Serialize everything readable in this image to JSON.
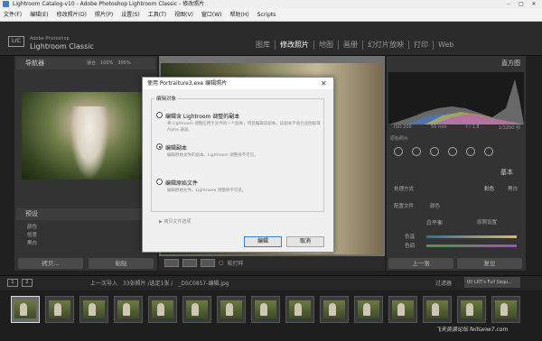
{
  "window": {
    "title": "Lightroom Catalog-v10 - Adobe Photoshop Lightroom Classic - 修改照片"
  },
  "menubar": [
    "文件(F)",
    "编辑(E)",
    "修改照片(D)",
    "照片(P)",
    "设置(S)",
    "工具(T)",
    "视图(V)",
    "窗口(W)",
    "帮助(H)",
    "Scripts"
  ],
  "header": {
    "logo": "LrC",
    "app_line1": "Adobe Photoshop",
    "app_line2": "Lightroom Classic",
    "modules": [
      "图库",
      "修改照片",
      "地图",
      "画册",
      "幻灯片放映",
      "打印",
      "Web"
    ],
    "active_module": "修改照片"
  },
  "left": {
    "navigator_title": "导航器",
    "zoom_options": [
      "适合",
      "100%",
      "300%"
    ],
    "presets_title": "预设",
    "presets": [
      "颜色",
      "创意",
      "黑白"
    ],
    "copy_button": "拷贝...",
    "paste_button": "粘贴"
  },
  "toolbar": {
    "soft_proof": "软打样"
  },
  "right": {
    "histogram_title": "直方图",
    "hist_values": [
      "ISO 200",
      "50 mm",
      "f / 1.8",
      "1/3200 秒"
    ],
    "original_photo": "原始照片",
    "basic_title": "基本",
    "treatment_label": "处理方式",
    "treatment_color": "彩色",
    "treatment_bw": "黑白",
    "profile_label": "配置文件",
    "profile_value": "颜色",
    "wb_label": "白平衡",
    "wb_value": "原照设置",
    "temp_label": "色温",
    "tint_label": "色调",
    "prev_button": "上一张",
    "reset_button": "复位"
  },
  "filmstrip": {
    "pages": [
      "1",
      "2"
    ],
    "info": "上一次导入",
    "count": "33张照片 /选定1张 /",
    "filename": "_DSC0857-编辑.jpg",
    "filter_label": "过滤器",
    "filter_value": "00 LRT's Full Sequ..."
  },
  "watermark": "飞天资源论坛 feitianw7.com",
  "dialog": {
    "title": "使用 Portraiture3.exe 编辑照片",
    "group_label": "编辑对象",
    "option1": "编辑含 Lightroom 调整的副本",
    "option1_desc": "将 Lightroom 调整应用于文件的一个副本，然后编辑该副本。该副本不会包含图层或 Alpha 通道。",
    "option2": "编辑副本",
    "option2_desc": "编辑原始文件的副本。Lightroom 调整将不可见。",
    "option3": "编辑原始文件",
    "option3_desc": "编辑原始文件。Lightroom 调整将不可见。",
    "copy_options": "拷贝文件选项",
    "edit_button": "编辑",
    "cancel_button": "取消",
    "selected_option": 2
  }
}
